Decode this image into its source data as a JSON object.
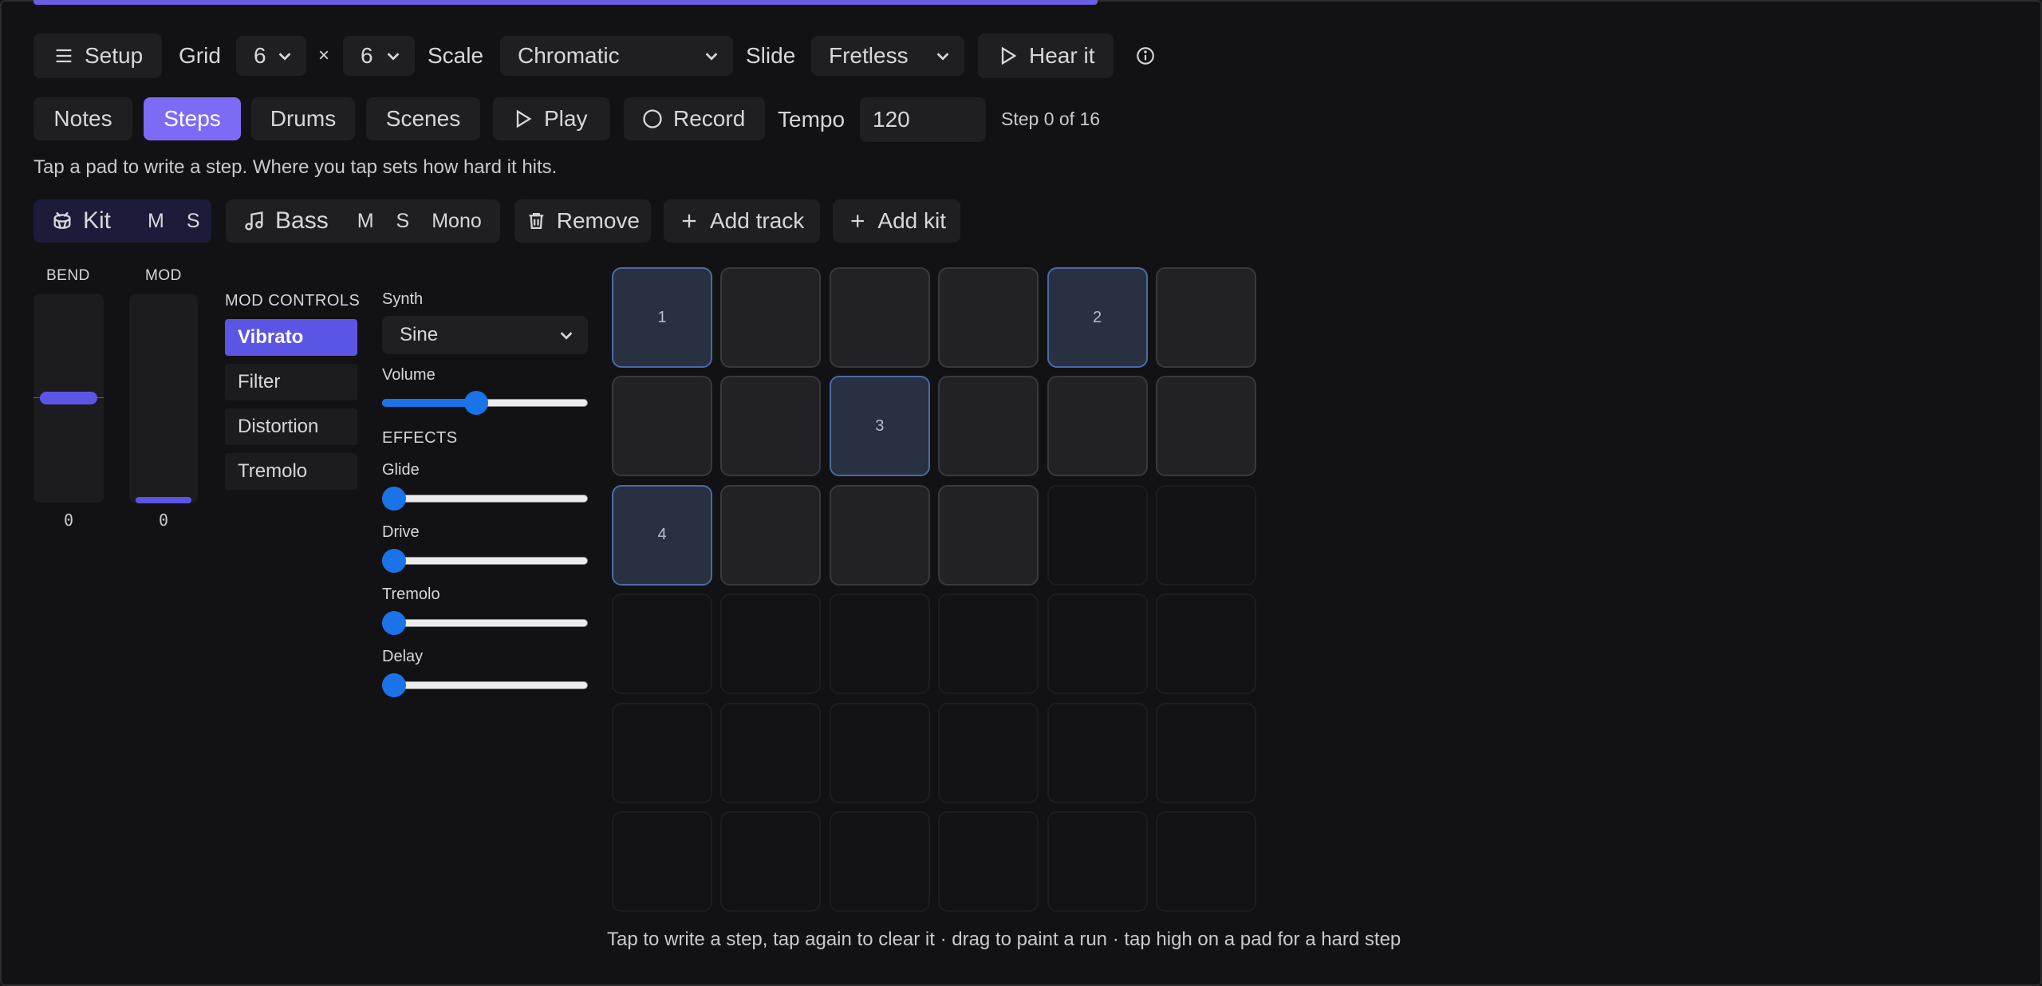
{
  "toolbar": {
    "setup_label": "Setup",
    "grid_label": "Grid",
    "grid_cols": "6",
    "times": "×",
    "grid_rows": "6",
    "scale_label": "Scale",
    "scale_value": "Chromatic",
    "slide_label": "Slide",
    "slide_value": "Fretless",
    "hear_label": "Hear it"
  },
  "modes": {
    "tabs": [
      {
        "label": "Notes",
        "active": false
      },
      {
        "label": "Steps",
        "active": true
      },
      {
        "label": "Drums",
        "active": false
      },
      {
        "label": "Scenes",
        "active": false
      }
    ],
    "play_label": "Play",
    "record_label": "Record",
    "tempo_label": "Tempo",
    "tempo_value": "120",
    "step_status": "Step 0 of 16"
  },
  "hint": "Tap a pad to write a step. Where you tap sets how hard it hits.",
  "tracks": {
    "kit": {
      "name": "Kit",
      "mute": "M",
      "solo": "S"
    },
    "bass": {
      "name": "Bass",
      "mute": "M",
      "solo": "S",
      "mono": "Mono"
    },
    "remove_label": "Remove",
    "add_track_label": "Add track",
    "add_kit_label": "Add kit"
  },
  "sliders": {
    "bend": {
      "label": "BEND",
      "value": "0"
    },
    "mod": {
      "label": "MOD",
      "value": "0"
    }
  },
  "mod_controls": {
    "title": "MOD CONTROLS",
    "items": [
      {
        "label": "Vibrato",
        "active": true
      },
      {
        "label": "Filter",
        "active": false
      },
      {
        "label": "Distortion",
        "active": false
      },
      {
        "label": "Tremolo",
        "active": false
      }
    ]
  },
  "synth": {
    "synth_label": "Synth",
    "synth_value": "Sine",
    "volume_label": "Volume",
    "volume_value": 0.45,
    "effects_title": "EFFECTS",
    "effects": [
      {
        "label": "Glide",
        "value": 0
      },
      {
        "label": "Drive",
        "value": 0
      },
      {
        "label": "Tremolo",
        "value": 0
      },
      {
        "label": "Delay",
        "value": 0
      }
    ]
  },
  "pads": {
    "cols": 6,
    "rows": 6,
    "active_count": 16,
    "steps": [
      {
        "index": 0,
        "label": "1"
      },
      {
        "index": 4,
        "label": "2"
      },
      {
        "index": 8,
        "label": "3"
      },
      {
        "index": 12,
        "label": "4"
      }
    ]
  },
  "footer": "Tap to write a step, tap again to clear it · drag to paint a run · tap high on a pad for a hard step",
  "colors": {
    "accent": "#7c6bf5",
    "mod_active": "#5b55e6",
    "step_pad": "#293041",
    "slider_blue": "#1a73e8"
  },
  "icons": {
    "setup": "menu-icon",
    "hear": "play-icon",
    "info": "info-icon",
    "play": "play-icon",
    "record": "record-icon",
    "kit": "drum-icon",
    "bass": "music-note-icon",
    "remove": "trash-icon",
    "add": "plus-icon"
  }
}
